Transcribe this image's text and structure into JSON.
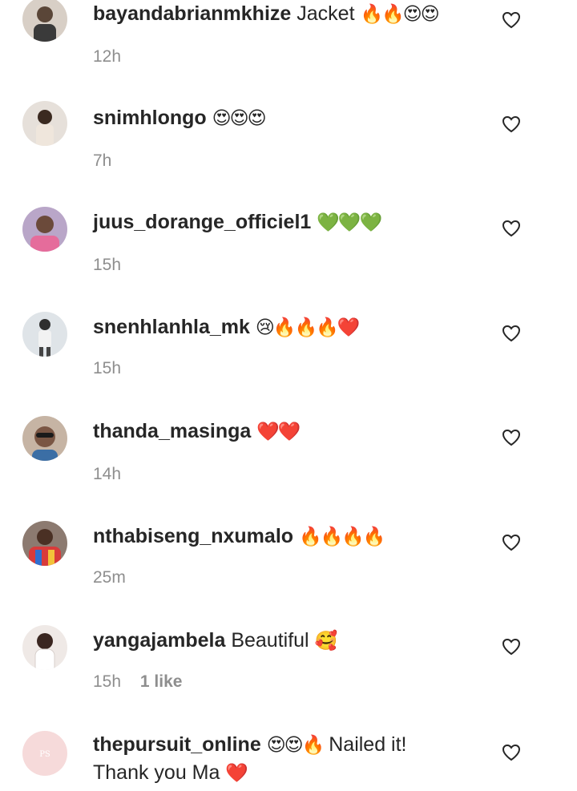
{
  "comments": [
    {
      "username": "bayandabrianmkhize",
      "text": "Jacket",
      "emoji": "🔥🔥😍😍",
      "time": "12h"
    },
    {
      "username": "snimhlongo",
      "text": "",
      "emoji": "😍😍😍",
      "time": "7h"
    },
    {
      "username": "juus_dorange_officiel1",
      "text": "",
      "emoji": "💚💚💚",
      "time": "15h"
    },
    {
      "username": "snenhlanhla_mk",
      "text": "",
      "emoji": "😢🔥🔥🔥❤️",
      "time": "15h"
    },
    {
      "username": "thanda_masinga",
      "text": "",
      "emoji": "❤️❤️",
      "time": "14h"
    },
    {
      "username": "nthabiseng_nxumalo",
      "text": "",
      "emoji": "🔥🔥🔥🔥",
      "time": "25m"
    },
    {
      "username": "yangajambela",
      "text": "Beautiful",
      "emoji": "🥰",
      "time": "15h",
      "likes": "1 like"
    },
    {
      "username": "thepursuit_online",
      "emoji_pre": "😍😍🔥",
      "text": "Nailed it!",
      "line2_text": "Thank you Ma",
      "line2_emoji": "❤️"
    }
  ],
  "avatar_colors": [
    "#c9b7a6",
    "#b59a84",
    "#9a8fb0",
    "#c7cfd6",
    "#a89585",
    "#8a6d64",
    "#d9cfc8",
    "#f7dede"
  ],
  "icons": {
    "like": "heart-outline-icon"
  },
  "colors": {
    "text": "#262626",
    "meta": "#8e8e8e",
    "pursuit_avatar": "#f5d6d6"
  }
}
